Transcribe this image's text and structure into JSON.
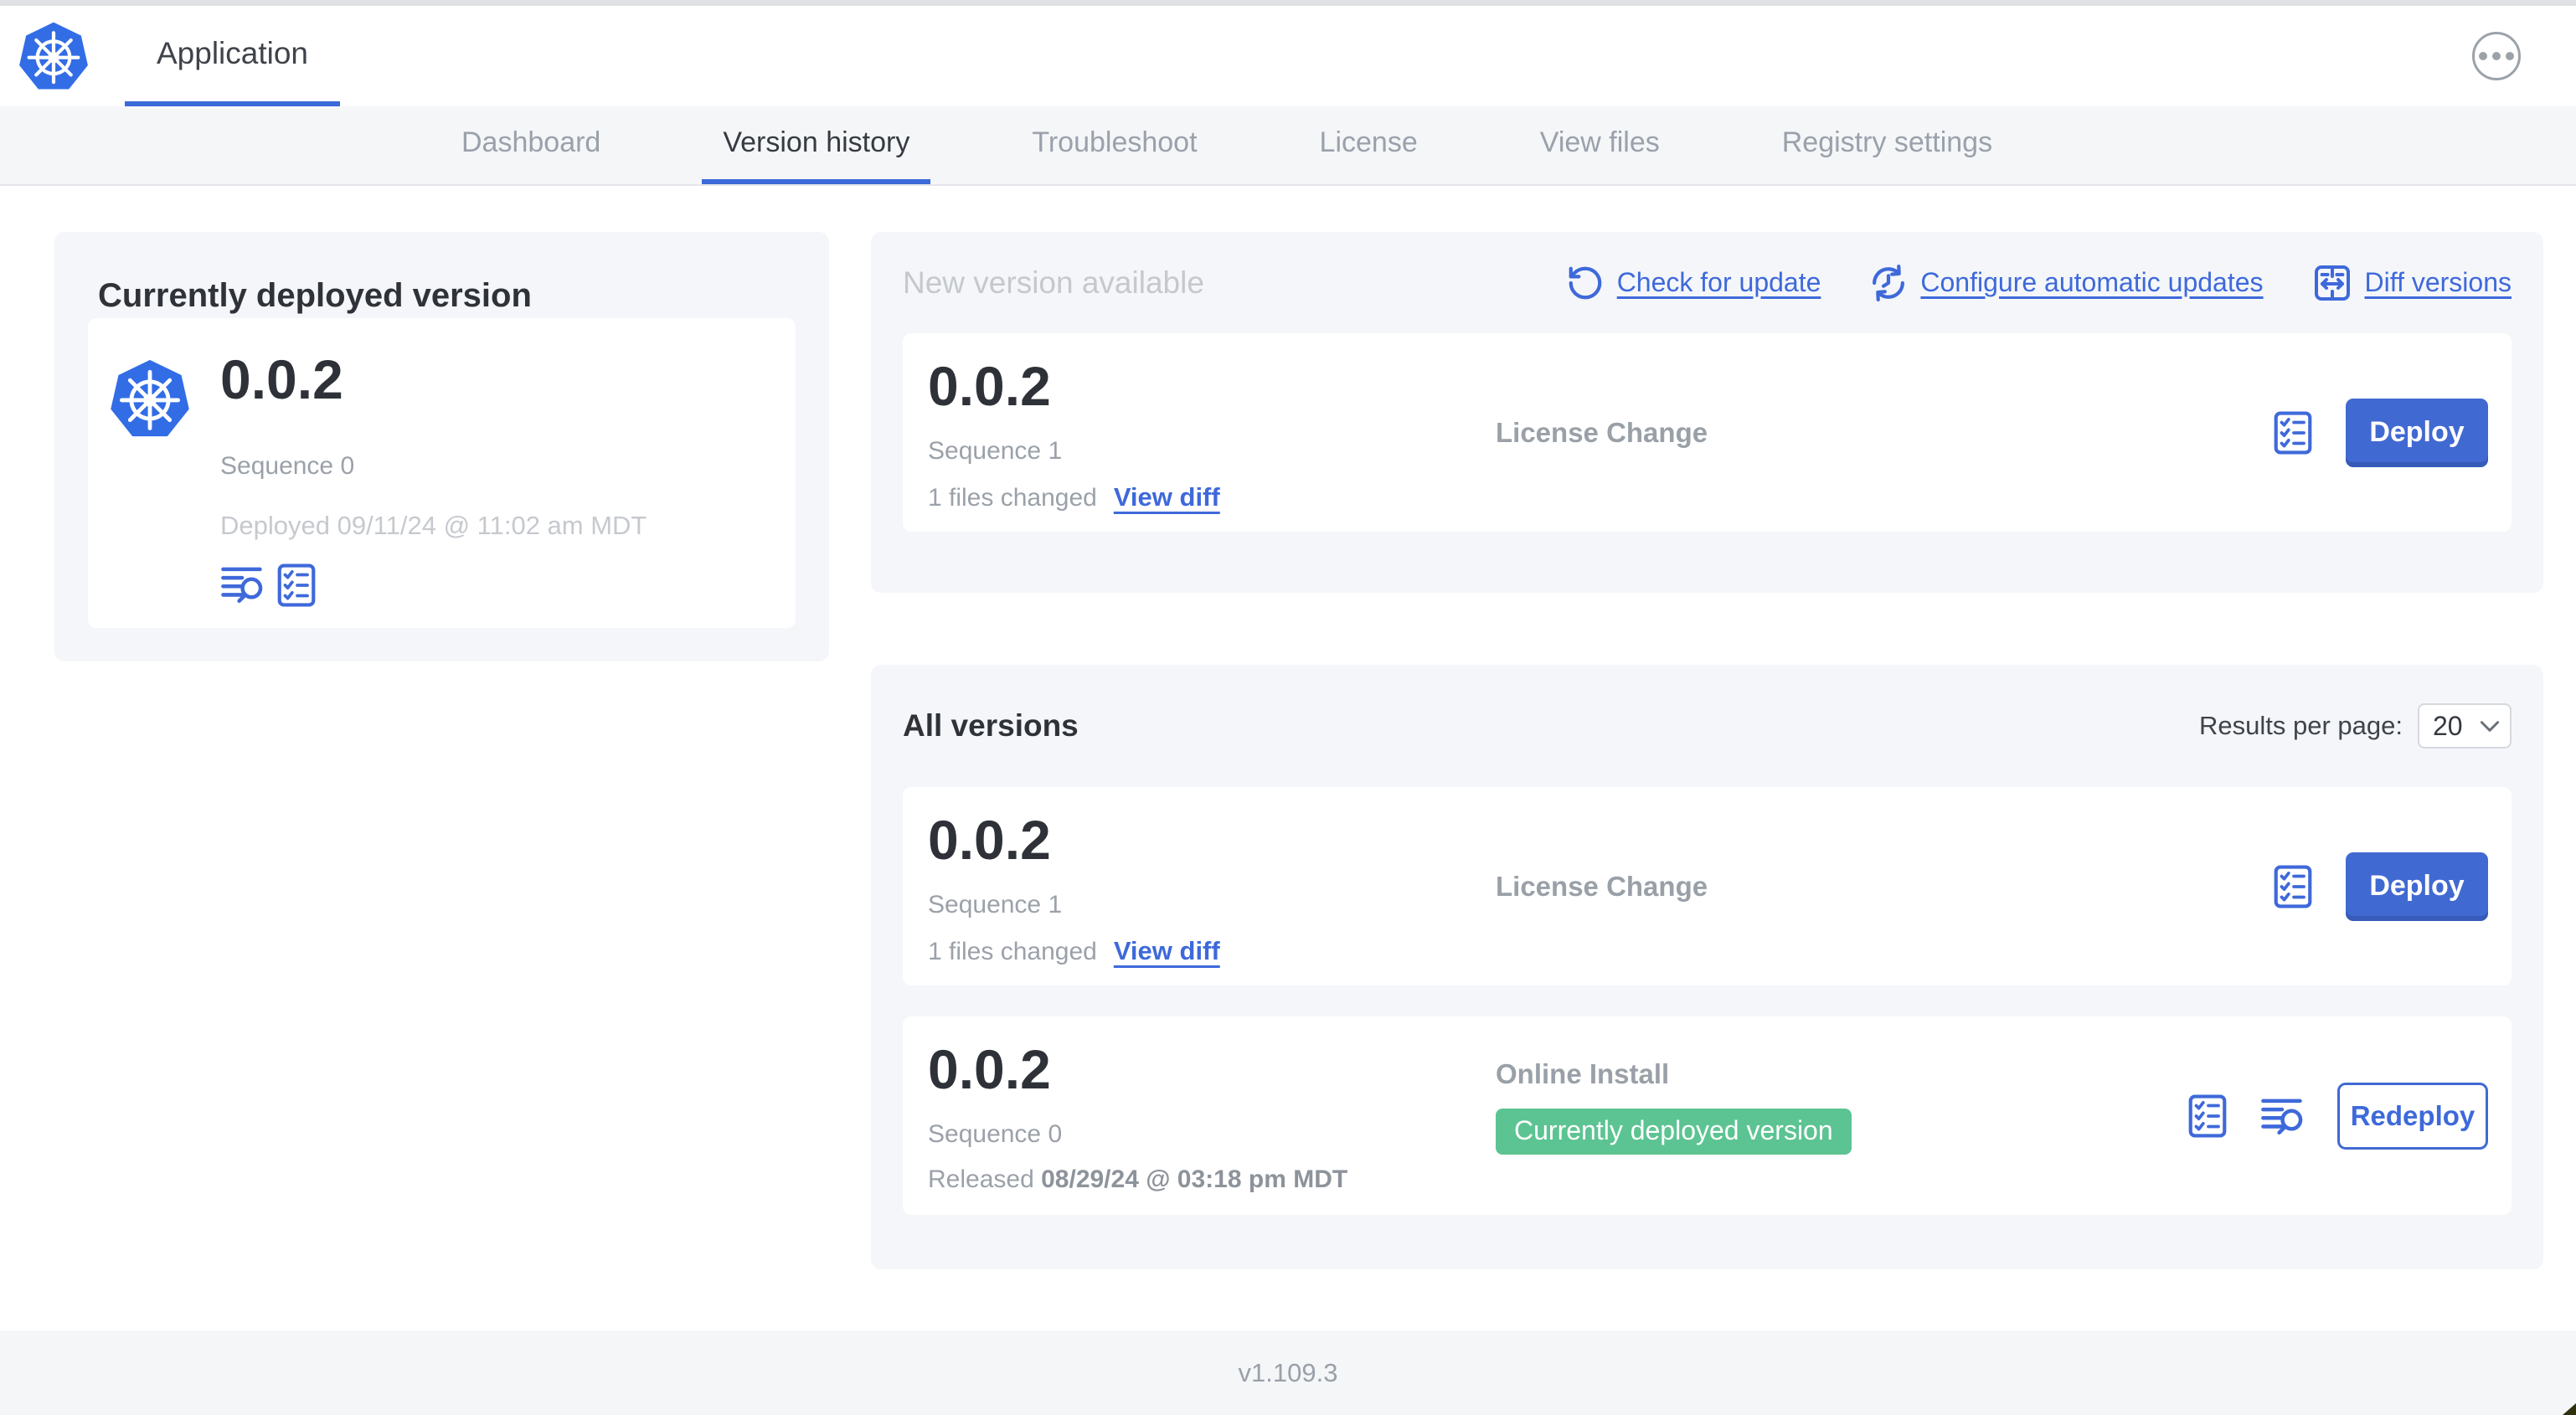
{
  "header": {
    "app_tab_label": "Application"
  },
  "nav": {
    "tabs": [
      {
        "label": "Dashboard",
        "active": false
      },
      {
        "label": "Version history",
        "active": true
      },
      {
        "label": "Troubleshoot",
        "active": false
      },
      {
        "label": "License",
        "active": false
      },
      {
        "label": "View files",
        "active": false
      },
      {
        "label": "Registry settings",
        "active": false
      }
    ]
  },
  "current_version": {
    "title": "Currently deployed version",
    "version": "0.0.2",
    "sequence": "Sequence 0",
    "deployed": "Deployed 09/11/24 @ 11:02 am MDT"
  },
  "new_version": {
    "title": "New version available",
    "actions": [
      {
        "label": "Check for update",
        "icon": "refresh-icon"
      },
      {
        "label": "Configure automatic updates",
        "icon": "schedule-icon"
      },
      {
        "label": "Diff versions",
        "icon": "diff-icon"
      }
    ],
    "card": {
      "version": "0.0.2",
      "sequence": "Sequence 1",
      "files_changed": "1 files changed",
      "view_diff": "View diff",
      "type": "License Change",
      "deploy": "Deploy"
    }
  },
  "all_versions": {
    "title": "All versions",
    "results_per_page": {
      "label": "Results per page:",
      "value": "20"
    },
    "rows": [
      {
        "version": "0.0.2",
        "sequence": "Sequence 1",
        "files_changed": "1 files changed",
        "view_diff": "View diff",
        "type": "License Change",
        "action": "Deploy"
      },
      {
        "version": "0.0.2",
        "sequence": "Sequence 0",
        "released_label": "Released",
        "released_date": "08/29/24 @ 03:18 pm MDT",
        "type": "Online Install",
        "badge": "Currently deployed version",
        "action": "Redeploy"
      }
    ]
  },
  "footer": {
    "version": "v1.109.3"
  },
  "colors": {
    "accent_link": "#3e69da",
    "button_blue": "#4169d2",
    "badge_green": "#5cc492",
    "k8s_blue": "#326de6"
  }
}
